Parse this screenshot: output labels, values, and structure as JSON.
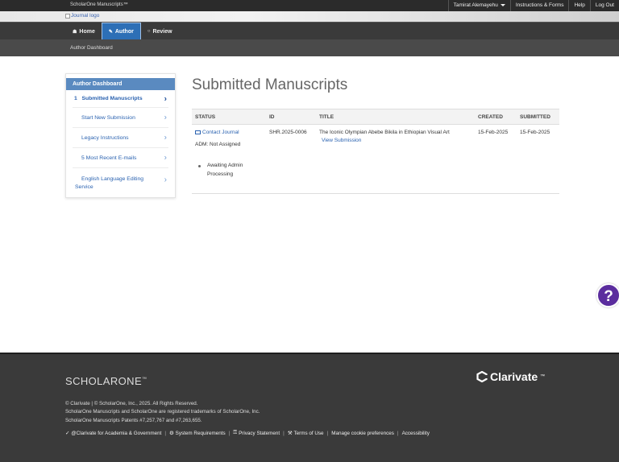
{
  "topbar": {
    "brand": "ScholarOne Manuscripts™",
    "user_name": "Tamirat Alemayehu",
    "instructions": "Instructions & Forms",
    "help": "Help",
    "logout": "Log Out"
  },
  "logo": {
    "alt": "Journal logo"
  },
  "nav": {
    "home": "Home",
    "author": "Author",
    "review": "Review"
  },
  "breadcrumb": "Author Dashboard",
  "sidebar": {
    "title": "Author Dashboard",
    "items": [
      {
        "label": "1   Submitted Manuscripts"
      },
      {
        "label": "Start New Submission"
      },
      {
        "label": "Legacy Instructions"
      },
      {
        "label": "5 Most Recent E-mails"
      },
      {
        "label": "English Language Editing Service"
      }
    ]
  },
  "main": {
    "title": "Submitted Manuscripts",
    "columns": [
      "STATUS",
      "ID",
      "TITLE",
      "CREATED",
      "SUBMITTED"
    ],
    "row": {
      "contact": "Contact Journal",
      "adm": "ADM: Not Assigned",
      "status": "Awaiting Admin Processing",
      "id": "SHR.2025-0006",
      "title": "The Iconic Olympian Abebe Bikila in Ethiopian Visual Art",
      "view": "View Submission",
      "created": "15-Feb-2025",
      "submitted": "15-Feb-2025"
    }
  },
  "help_bubble": "?",
  "footer": {
    "logo": "SCHOLARONE",
    "logo_tm": "™",
    "clarivate": "Clarivate",
    "clarivate_tm": "™",
    "line1": "© Clarivate  |  © ScholarOne, Inc., 2025. All Rights Reserved.",
    "line2": "ScholarOne Manuscripts and ScholarOne are registered trademarks of ScholarOne, Inc.",
    "line3": "ScholarOne Manuscripts Patents #7,257,767 and #7,263,655.",
    "links": [
      "@Clarivate for Academia & Government",
      "System Requirements",
      "Privacy Statement",
      "Terms of Use",
      "Manage cookie preferences",
      "Accessibility"
    ]
  },
  "colors": {
    "nav_active": "#2d6fb6",
    "link": "#2a62b0",
    "sidebar_head": "#5a8ac0",
    "help_bubble": "#5b2d9e",
    "footer_bg": "#3a3a3a"
  }
}
